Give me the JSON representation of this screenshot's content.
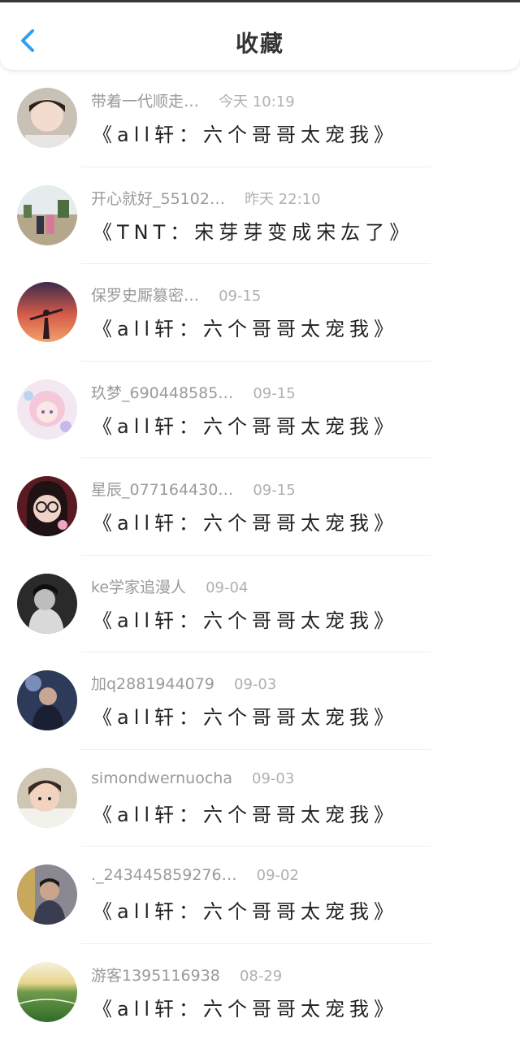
{
  "header": {
    "title": "收藏",
    "back_icon": "chevron-left-icon",
    "accent": "#2f9ef5"
  },
  "items": [
    {
      "user": "带着一代顺走…",
      "time": "今天 10:19",
      "title": "《all轩：六个哥哥太宠我》"
    },
    {
      "user": "开心就好_55102…",
      "time": "昨天 22:10",
      "title": "《TNT：宋芽芽变成宋厷了》"
    },
    {
      "user": "保罗史厮篡密…",
      "time": "09-15",
      "title": "《all轩：六个哥哥太宠我》"
    },
    {
      "user": "玖梦_690448585…",
      "time": "09-15",
      "title": "《all轩：六个哥哥太宠我》"
    },
    {
      "user": "星辰_077164430…",
      "time": "09-15",
      "title": "《all轩：六个哥哥太宠我》"
    },
    {
      "user": "ke学家追漫人",
      "time": "09-04",
      "title": "《all轩：六个哥哥太宠我》"
    },
    {
      "user": "加q2881944079",
      "time": "09-03",
      "title": "《all轩：六个哥哥太宠我》"
    },
    {
      "user": "simondwernuocha",
      "time": "09-03",
      "title": "《all轩：六个哥哥太宠我》"
    },
    {
      "user": "._243445859276…",
      "time": "09-02",
      "title": "《all轩：六个哥哥太宠我》"
    },
    {
      "user": "游客1395116938",
      "time": "08-29",
      "title": "《all轩：六个哥哥太宠我》"
    }
  ]
}
